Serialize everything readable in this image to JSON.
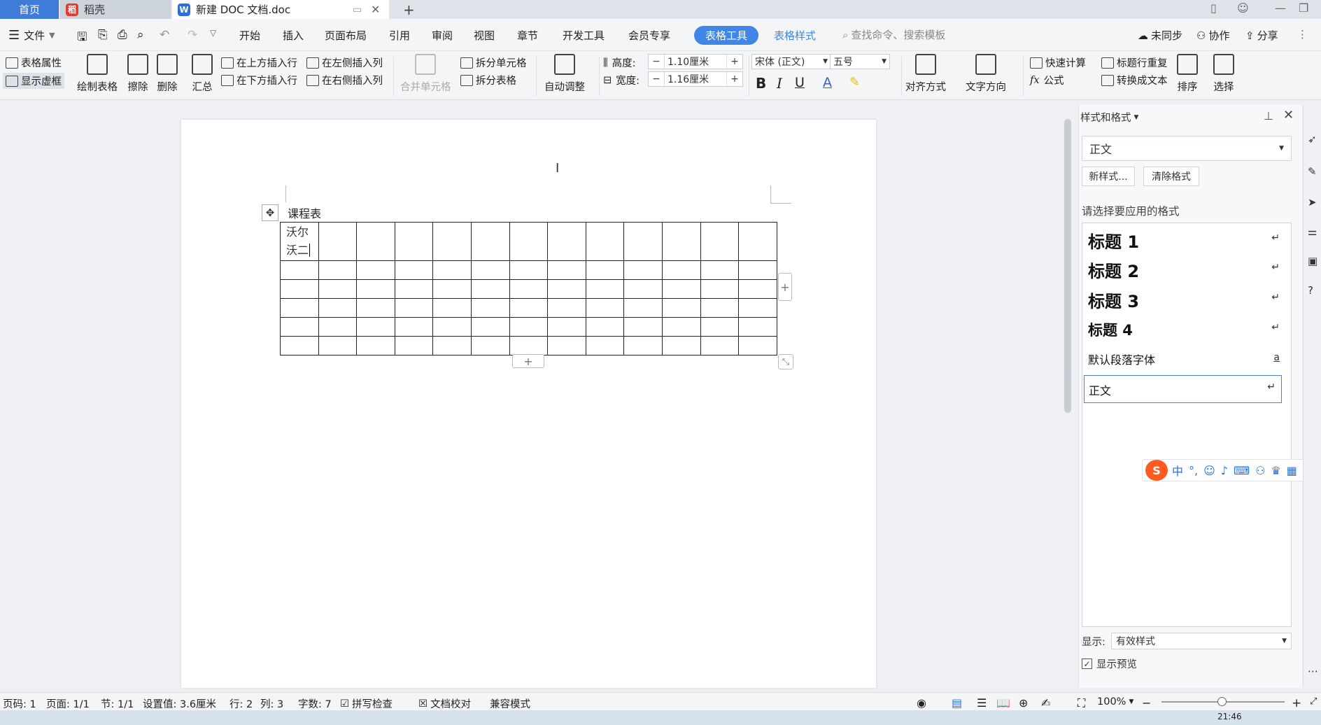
{
  "tabs": {
    "home": "首页",
    "daoke": "稻壳",
    "doc": "新建 DOC 文档.doc",
    "new_tab": "+"
  },
  "menubar": {
    "file": "文件",
    "items": [
      "开始",
      "插入",
      "页面布局",
      "引用",
      "审阅",
      "视图",
      "章节",
      "开发工具",
      "会员专享"
    ],
    "active_tool": "表格工具",
    "table_style": "表格样式",
    "search_placeholder": "查找命令、搜索模板",
    "sync": "未同步",
    "collab": "协作",
    "share": "分享"
  },
  "ribbon": {
    "table_props": "表格属性",
    "show_grid": "显示虚框",
    "draw_table": "绘制表格",
    "erase": "擦除",
    "delete": "删除",
    "summary": "汇总",
    "insert_above": "在上方插入行",
    "insert_below": "在下方插入行",
    "insert_left": "在左侧插入列",
    "insert_right": "在右侧插入列",
    "merge_cells": "合并单元格",
    "split_cells": "拆分单元格",
    "split_table": "拆分表格",
    "auto_fit": "自动调整",
    "height_label": "高度:",
    "height_value": "1.10厘米",
    "width_label": "宽度:",
    "width_value": "1.16厘米",
    "font_name": "宋体 (正文)",
    "font_size": "五号",
    "align": "对齐方式",
    "text_dir": "文字方向",
    "quick_calc": "快速计算",
    "formula": "公式",
    "title_repeat": "标题行重复",
    "to_text": "转换成文本",
    "sort": "排序",
    "select": "选择"
  },
  "document": {
    "table_title": "课程表",
    "cell_line1": "沃尔",
    "cell_line2": "沃二"
  },
  "style_panel": {
    "title": "样式和格式",
    "current_style": "正文",
    "new_style": "新样式...",
    "clear_format": "清除格式",
    "prompt": "请选择要应用的格式",
    "styles": [
      "标题 1",
      "标题 2",
      "标题 3",
      "标题 4",
      "默认段落字体",
      "正文"
    ],
    "display_label": "显示:",
    "display_value": "有效样式",
    "show_preview": "显示预览"
  },
  "statusbar": {
    "page_num": "页码: 1",
    "pages": "页面: 1/1",
    "section": "节: 1/1",
    "setting": "设置值: 3.6厘米",
    "row": "行: 2",
    "col": "列: 3",
    "word_count": "字数: 7",
    "spell_check": "拼写检查",
    "proofread": "文档校对",
    "compat": "兼容模式",
    "zoom": "100%"
  },
  "taskbar": {
    "time": "21:46"
  },
  "colors": {
    "accent": "#3f86e6",
    "home_tab": "#3f7cd8"
  }
}
